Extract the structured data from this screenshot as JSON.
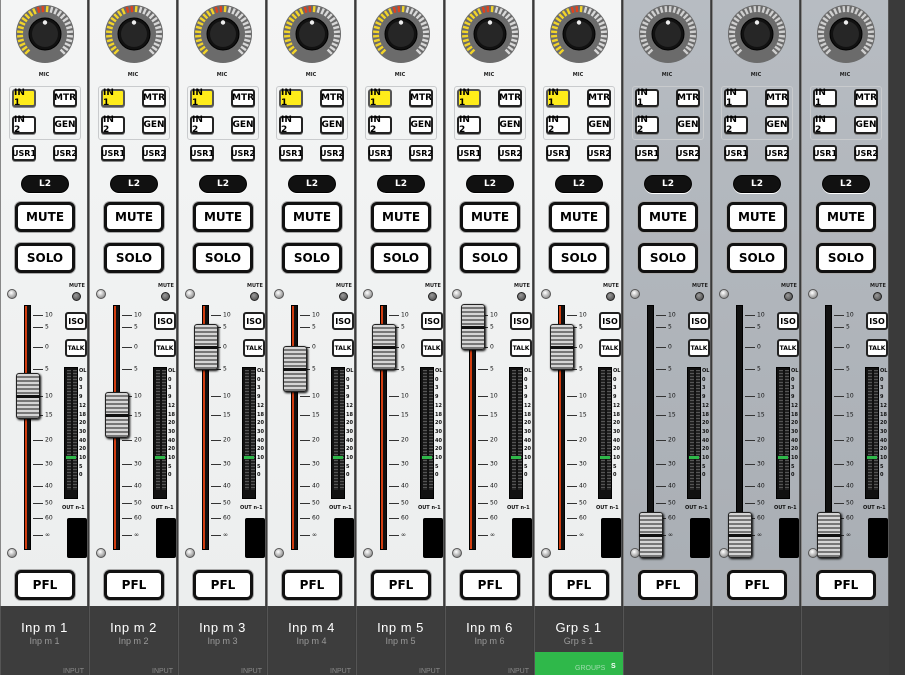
{
  "strips": [
    {
      "name": "Inp m  1",
      "sub": "Inp m  1",
      "type": "INPUT",
      "gain_pct": 0.55,
      "active": true,
      "fader_db": "-10"
    },
    {
      "name": "Inp m  2",
      "sub": "Inp m  2",
      "type": "INPUT",
      "gain_pct": 0.55,
      "active": true,
      "fader_db": "-15"
    },
    {
      "name": "Inp m  3",
      "sub": "Inp m  3",
      "type": "INPUT",
      "gain_pct": 0.55,
      "active": true,
      "fader_db": "0"
    },
    {
      "name": "Inp m  4",
      "sub": "Inp m  4",
      "type": "INPUT",
      "gain_pct": 0.55,
      "active": true,
      "fader_db": "-5"
    },
    {
      "name": "Inp m  5",
      "sub": "Inp m  5",
      "type": "INPUT",
      "gain_pct": 0.55,
      "active": true,
      "fader_db": "0"
    },
    {
      "name": "Inp m  6",
      "sub": "Inp m  6",
      "type": "INPUT",
      "gain_pct": 0.55,
      "active": true,
      "fader_db": "5"
    },
    {
      "name": "Grp s  1",
      "sub": "Grp s  1",
      "type": "GROUPS",
      "gain_pct": 0.55,
      "active": true,
      "fader_db": "0",
      "group_badge": "S"
    },
    {
      "name": "",
      "sub": "",
      "type": "",
      "gain_pct": 0.5,
      "active": false,
      "fader_db": "∞"
    },
    {
      "name": "",
      "sub": "",
      "type": "",
      "gain_pct": 0.5,
      "active": false,
      "fader_db": "∞"
    },
    {
      "name": "",
      "sub": "",
      "type": "",
      "gain_pct": 0.5,
      "active": false,
      "fader_db": "∞"
    }
  ],
  "labels": {
    "mic": "MIC",
    "in1": "IN 1",
    "mtr": "MTR",
    "in2": "IN 2",
    "gen": "GEN",
    "usr1": "USR1",
    "usr2": "USR2",
    "l2": "L2",
    "mute": "MUTE",
    "solo": "SOLO",
    "pfl": "PFL",
    "mute_led": "MUTE",
    "iso": "ISO",
    "talk": "TALK",
    "out": "OUT n-1"
  },
  "fader_scale": [
    "10",
    "5",
    "0",
    "5",
    "10",
    "15",
    "20",
    "30",
    "40",
    "50",
    "60",
    "∞"
  ],
  "meter_scale": [
    "OL",
    "0",
    "3",
    "9",
    "12",
    "18",
    "20",
    "30",
    "40",
    "20",
    "10",
    "5",
    "0"
  ],
  "colors": {
    "accent_on": "#ffec1a",
    "fader_red": "#d23d10",
    "group_green": "#2fb84a",
    "meter_green": "#2fb84a"
  }
}
